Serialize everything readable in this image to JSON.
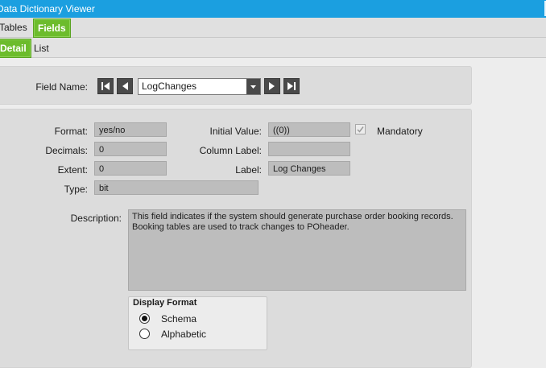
{
  "window": {
    "title": "Data Dictionary Viewer"
  },
  "top_tabs": [
    {
      "label": "Tables",
      "active": false
    },
    {
      "label": "Fields",
      "active": true
    }
  ],
  "sub_tabs": [
    {
      "label": "Detail",
      "active": true
    },
    {
      "label": "List",
      "active": false
    }
  ],
  "field_name": {
    "label": "Field Name:",
    "value": "LogChanges"
  },
  "details": {
    "format": {
      "label": "Format:",
      "value": "yes/no"
    },
    "decimals": {
      "label": "Decimals:",
      "value": "0"
    },
    "extent": {
      "label": "Extent:",
      "value": "0"
    },
    "type": {
      "label": "Type:",
      "value": "bit"
    },
    "initial_value": {
      "label": "Initial Value:",
      "value": "((0))"
    },
    "column_label": {
      "label": "Column Label:",
      "value": ""
    },
    "label": {
      "label": "Label:",
      "value": "Log Changes"
    },
    "mandatory": {
      "label": "Mandatory",
      "checked": true
    },
    "description": {
      "label": "Description:",
      "value": "This field indicates if the system should generate purchase order booking records. Booking tables are used to track changes to POheader."
    }
  },
  "display_format": {
    "title": "Display Format",
    "options": [
      {
        "label": "Schema",
        "selected": true
      },
      {
        "label": "Alphabetic",
        "selected": false
      }
    ]
  },
  "colors": {
    "titlebar": "#1b9fe0",
    "active_tab": "#6cbc2c",
    "field_bg": "#bdbdbd"
  }
}
